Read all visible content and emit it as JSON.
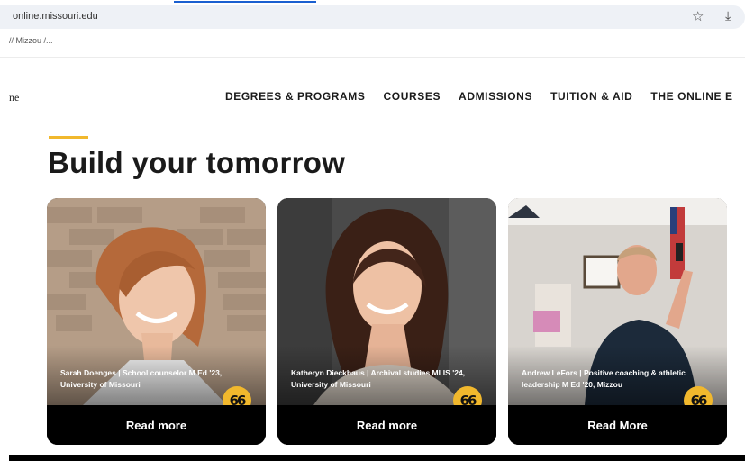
{
  "browser": {
    "url": "online.missouri.edu",
    "bookmarks_text": "// Mizzou /...",
    "star_icon": "star-icon",
    "download_icon": "download-icon"
  },
  "site": {
    "brand_partial": "ne",
    "nav": [
      {
        "label": "DEGREES & PROGRAMS"
      },
      {
        "label": "COURSES"
      },
      {
        "label": "ADMISSIONS"
      },
      {
        "label": "TUITION & AID"
      },
      {
        "label": "THE ONLINE E"
      }
    ],
    "heading": "Build your tomorrow"
  },
  "cards": [
    {
      "caption": "Sarah Doenges | School counselor M Ed '23, University of Missouri",
      "cta": "Read more",
      "quote_glyph": "66"
    },
    {
      "caption": "Katheryn Dieckhaus | Archival studies MLIS '24, University of Missouri",
      "cta": "Read more",
      "quote_glyph": "66"
    },
    {
      "caption": "Andrew LeFors | Positive coaching & athletic leadership M Ed '20, Mizzou",
      "cta": "Read More",
      "quote_glyph": "66"
    }
  ],
  "colors": {
    "accent_gold": "#f1b82d",
    "text_dark": "#1a1a1a",
    "card_bg": "#000000",
    "addressbar_bg": "#eef1f6"
  }
}
